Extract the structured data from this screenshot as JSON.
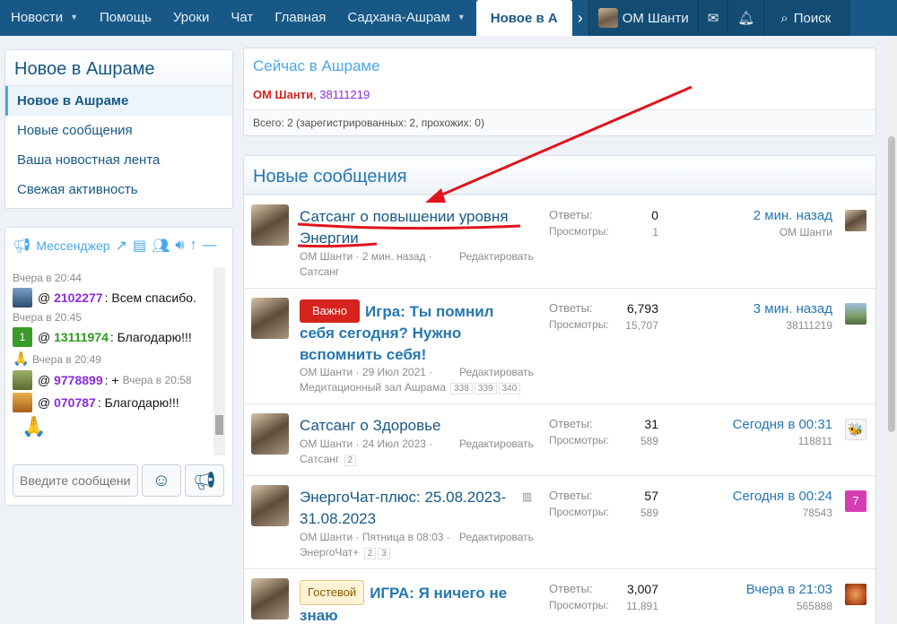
{
  "nav": {
    "tabs": [
      "Новости",
      "Помощь",
      "Уроки",
      "Чат",
      "Главная",
      "Садхана-Ашрам"
    ],
    "active_tab": "Новое в А",
    "user": "ОМ Шанти",
    "search": "Поиск"
  },
  "sidebar": {
    "title": "Новое в Ашраме",
    "items": [
      "Новое в Ашраме",
      "Новые сообщения",
      "Ваша новостная лента",
      "Свежая активность"
    ]
  },
  "chat": {
    "title": "Мессенджер",
    "input_placeholder": "Введите сообщение",
    "log": [
      {
        "time": "Вчера в 20:44"
      },
      {
        "user": "2102277",
        "text": ": Всем спасибо.",
        "color": "#8a2be2"
      },
      {
        "time": "Вчера в 20:45"
      },
      {
        "user": "13111974",
        "text": ": Благодарю!!!",
        "color": "#2a9c1f",
        "avatar_text": "1"
      },
      {
        "time": "Вчера в 20:49"
      },
      {
        "user": "9778899",
        "text": ": +",
        "color": "#8a2be2",
        "time_inline": "Вчера в 20:58"
      },
      {
        "user": "070787",
        "text": ": Благодарю!!!",
        "color": "#8a2be2"
      }
    ]
  },
  "now": {
    "title": "Сейчас в Ашраме",
    "user1": "ОМ Шанти",
    "user2": "38111219",
    "total": "Всего: 2 (зарегистрированных: 2, прохожих: 0)"
  },
  "new_posts": {
    "title": "Новые сообщения",
    "replies_label": "Ответы:",
    "views_label": "Просмотры:",
    "edit_label": "Редактировать",
    "threads": [
      {
        "badge": "",
        "title": "Сатсанг о повышении уровня Энергии",
        "author": "ОМ Шанти",
        "date": "2 мин. назад",
        "forum": "Сатсанг",
        "pages": [],
        "replies": "0",
        "views": "1",
        "last_time": "2 мин. назад",
        "last_user": "ОМ Шанти"
      },
      {
        "badge": "Важно",
        "title": "Игра: Ты помнил себя сегодня? Нужно вспомнить себя!",
        "author": "ОМ Шанти",
        "date": "29 Июл 2021",
        "forum": "Медитационный зал Ашрама",
        "pages": [
          "338",
          "339",
          "340"
        ],
        "replies": "6,793",
        "views": "15,707",
        "last_time": "3 мин. назад",
        "last_user": "38111219"
      },
      {
        "badge": "",
        "title": "Сатсанг о Здоровье",
        "author": "ОМ Шанти",
        "date": "24 Июл 2023",
        "forum": "Сатсанг",
        "pages": [
          "2"
        ],
        "replies": "31",
        "views": "589",
        "last_time": "Сегодня в 00:31",
        "last_user": "118811"
      },
      {
        "badge": "",
        "title": "ЭнергоЧат-плюс: 25.08.2023-31.08.2023",
        "author": "ОМ Шанти",
        "date": "Пятница в 08:03",
        "forum": "ЭнергоЧат+",
        "pages": [
          "2",
          "3"
        ],
        "replies": "57",
        "views": "589",
        "last_time": "Сегодня в 00:24",
        "last_user": "78543",
        "last_avatar_text": "7"
      },
      {
        "badge": "Гостевой",
        "title": "ИГРА: Я ничего не знаю",
        "author": "",
        "date": "",
        "forum": "",
        "pages": [],
        "replies": "3,007",
        "views": "11,891",
        "last_time": "Вчера в 21:03",
        "last_user": "565888"
      }
    ]
  },
  "colors": {
    "nav": "#185886",
    "link": "#2577b1",
    "important": "#d6231e",
    "guest_bg": "#fff3d6",
    "annotation": "#e0141e"
  }
}
